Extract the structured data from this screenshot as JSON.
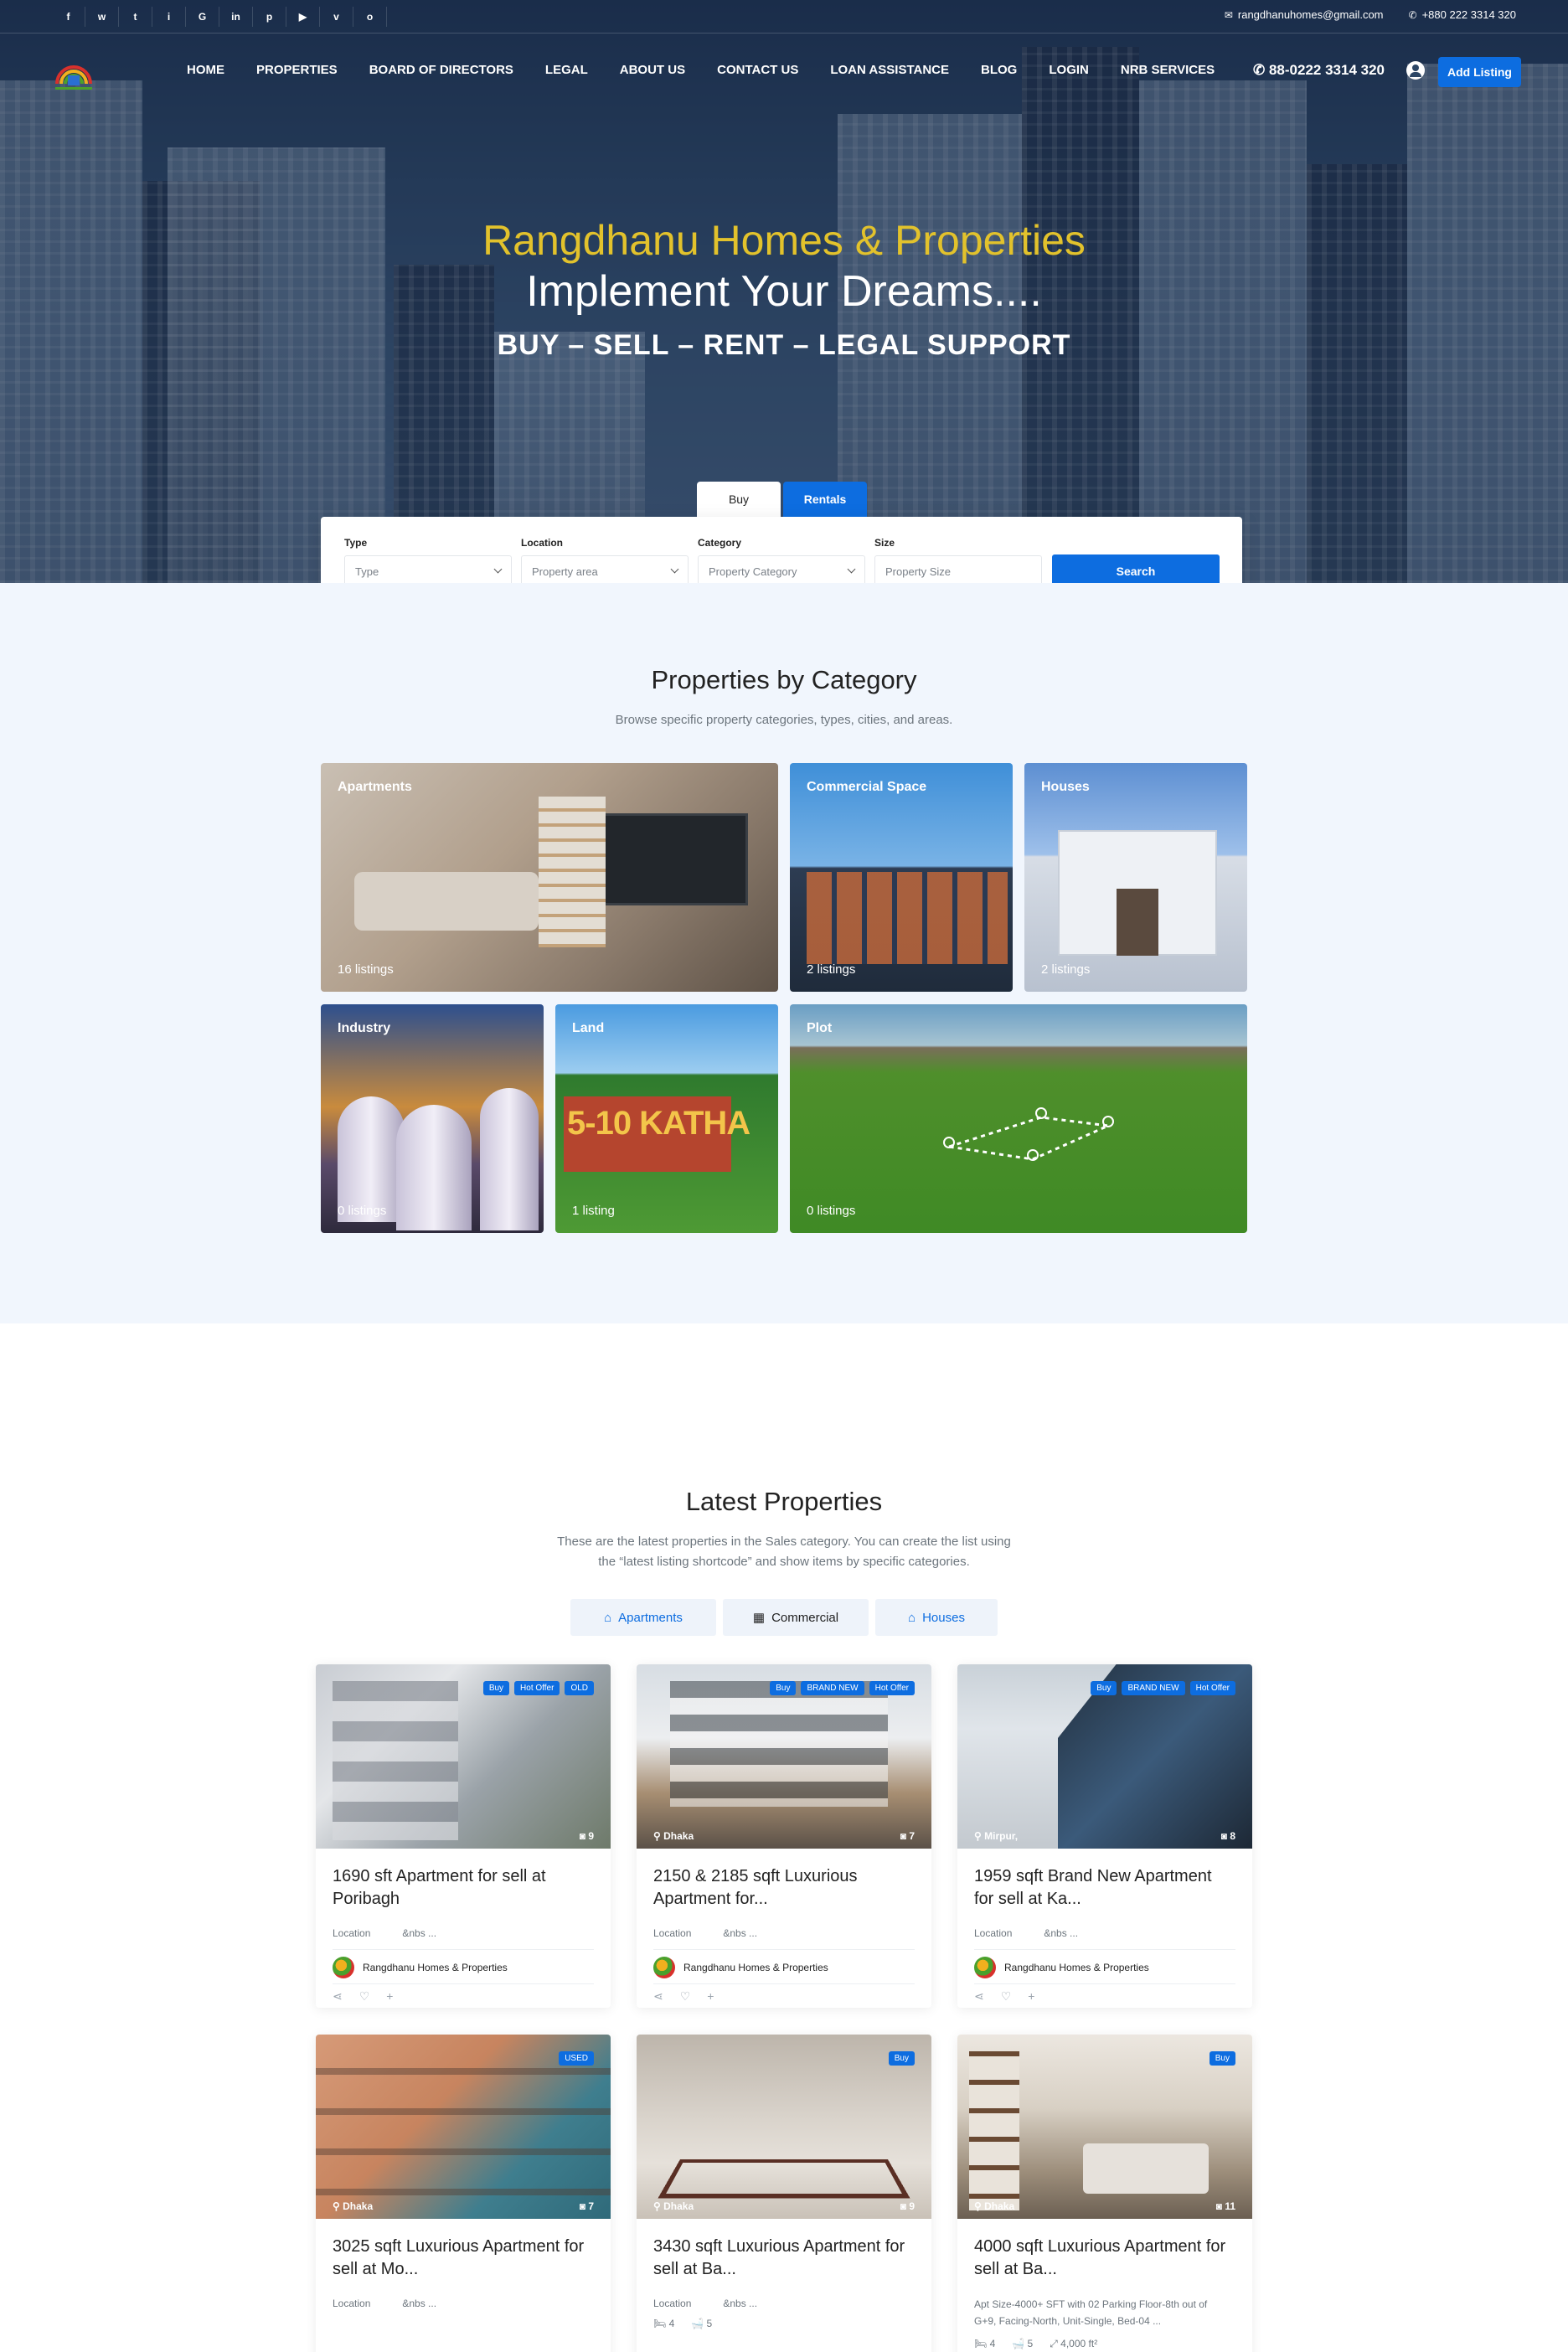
{
  "topbar": {
    "social": [
      "f",
      "w",
      "t",
      "i",
      "G",
      "in",
      "p",
      "▶",
      "v",
      "o"
    ],
    "email": "rangdhanuhomes@gmail.com",
    "phone": "+880 222 3314 320"
  },
  "nav": {
    "items": [
      "HOME",
      "PROPERTIES",
      "BOARD OF DIRECTORS",
      "LEGAL",
      "ABOUT US",
      "CONTACT US",
      "LOAN ASSISTANCE",
      "BLOG",
      "LOGIN",
      "NRB SERVICES"
    ],
    "phone": "88-0222 3314 320",
    "add_listing": "Add Listing"
  },
  "hero": {
    "brand": "Rangdhanu Homes & Properties",
    "tagline": "Implement Your Dreams....",
    "sub": "BUY – SELL – RENT – LEGAL SUPPORT"
  },
  "search": {
    "tabs": [
      "Buy",
      "Rentals"
    ],
    "fields": [
      {
        "label": "Type",
        "placeholder": "Type"
      },
      {
        "label": "Location",
        "placeholder": "Property area"
      },
      {
        "label": "Category",
        "placeholder": "Property Category"
      },
      {
        "label": "Size",
        "placeholder": "Property Size"
      }
    ],
    "button": "Search"
  },
  "categories": {
    "title": "Properties by Category",
    "subtitle": "Browse specific property categories, types, cities, and areas.",
    "items": [
      {
        "name": "Apartments",
        "count": "16 listings"
      },
      {
        "name": "Commercial Space",
        "count": "2 listings"
      },
      {
        "name": "Houses",
        "count": "2 listings"
      },
      {
        "name": "Industry",
        "count": "0 listings"
      },
      {
        "name": "Land",
        "count": "1 listing"
      },
      {
        "name": "Plot",
        "count": "0 listings"
      }
    ],
    "land_sign": "5-10 KATHA"
  },
  "latest": {
    "title": "Latest Properties",
    "subtitle_1": "These are the latest properties in the Sales category. You can create the list using",
    "subtitle_2": "the “latest listing shortcode” and show items by specific categories.",
    "filters": [
      "Apartments",
      "Commercial",
      "Houses"
    ],
    "cards": [
      {
        "title": "1690 sft Apartment for sell at Poribagh",
        "badges": [
          "Buy",
          "Hot Offer",
          "OLD"
        ],
        "location": "",
        "photos": "9",
        "meta_label": "Location",
        "meta_value": "&nbs ...",
        "agent": "Rangdhanu Homes & Properties"
      },
      {
        "title": "2150 & 2185 sqft Luxurious Apartment for...",
        "badges": [
          "Buy",
          "BRAND NEW",
          "Hot Offer"
        ],
        "location": "Dhaka",
        "photos": "7",
        "meta_label": "Location",
        "meta_value": "&nbs ...",
        "agent": "Rangdhanu Homes & Properties"
      },
      {
        "title": "1959 sqft Brand New Apartment for sell at Ka...",
        "badges": [
          "Buy",
          "BRAND NEW",
          "Hot Offer"
        ],
        "location": "Mirpur,",
        "photos": "8",
        "meta_label": "Location",
        "meta_value": "&nbs ...",
        "agent": "Rangdhanu Homes & Properties"
      },
      {
        "title": "3025 sqft Luxurious Apartment for sell at Mo...",
        "badges": [
          "USED"
        ],
        "location": "Dhaka",
        "photos": "7",
        "meta_label": "Location",
        "meta_value": "&nbs ..."
      },
      {
        "title": "3430 sqft Luxurious Apartment for sell at Ba...",
        "badges": [
          "Buy"
        ],
        "location": "Dhaka",
        "photos": "9",
        "meta_label": "Location",
        "meta_value": "&nbs ...",
        "beds": "4",
        "baths": "5"
      },
      {
        "title": "4000 sqft Luxurious Apartment for sell at Ba...",
        "badges": [
          "Buy"
        ],
        "location": "Dhaka",
        "photos": "11",
        "desc_1": "Apt Size-4000+ SFT with 02 Parking Floor-8th out of",
        "desc_2": "G+9, Facing-North, Unit-Single, Bed-04 ...",
        "beds": "4",
        "baths": "5",
        "area": "4,000 ft²"
      }
    ]
  }
}
